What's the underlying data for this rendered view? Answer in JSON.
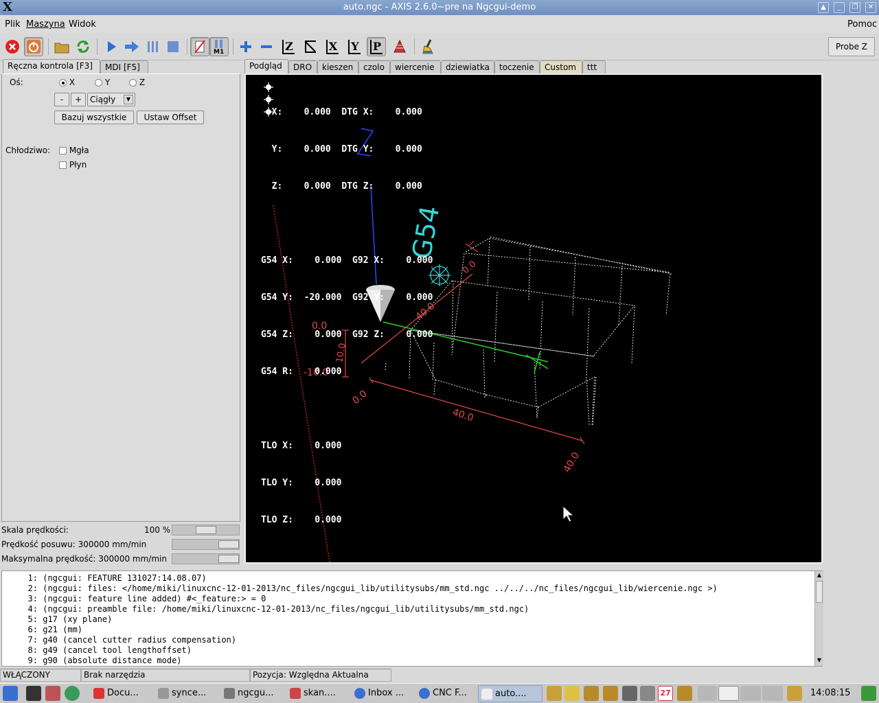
{
  "window": {
    "title": "auto.ngc - AXIS 2.6.0~pre na Ngcgui-demo"
  },
  "menu": [
    "Plik",
    "Maszyna",
    "Widok"
  ],
  "menu_help": "Pomoc",
  "toolbar": {
    "probe_label": "Probe Z",
    "z_label": "Z",
    "y_label": "Y",
    "x_label": "X",
    "p_label": "P"
  },
  "left_tabs": [
    "Ręczna kontrola [F3]",
    "MDI [F5]"
  ],
  "manual": {
    "axis_label": "Oś:",
    "axes": [
      "X",
      "Y",
      "Z"
    ],
    "minus": "-",
    "plus": "+",
    "jog_mode": "Ciągły",
    "home_all": "Bazuj wszystkie",
    "set_offset": "Ustaw Offset",
    "coolant_label": "Chłodziwo:",
    "mist": "Mgła",
    "flood": "Płyn"
  },
  "overrides": {
    "speed_scale_label": "Skala prędkości:",
    "speed_scale_value": "100 %",
    "feed_label": "Prędkość posuwu: 300000 mm/min",
    "max_vel_label": "Maksymalna prędkość: 300000 mm/min"
  },
  "preview_tabs": [
    "Podgląd",
    "DRO",
    "kieszen",
    "czolo",
    "wiercenie",
    "dziewiatka",
    "toczenie",
    "Custom",
    "ttt"
  ],
  "dro": [
    "  X:    0.000  DTG X:    0.000",
    "  Y:    0.000  DTG Y:    0.000",
    "  Z:    0.000  DTG Z:    0.000",
    "",
    "G54 X:    0.000  G92 X:    0.000",
    "G54 Y:  -20.000  G92 Y:    0.000",
    "G54 Z:    0.000  G92 Z:    0.000",
    "G54 R:    0.000",
    "",
    "TLO X:    0.000",
    "TLO Y:    0.000",
    "TLO Z:    0.000"
  ],
  "plot_labels": {
    "g54": "G54",
    "x_top": "40.0",
    "x_bottom": "40.0",
    "x_zero": "0.0",
    "y_end": "40.0",
    "z_zero": "0.0",
    "z_ten": "10.0",
    "z_neg": "-10.0",
    "y_zero": "0.0"
  },
  "code_lines": [
    {
      "n": "1:",
      "t": "(ngcgui: FEATURE 131027:14.08.07)"
    },
    {
      "n": "2:",
      "t": "(ngcgui: files: </home/miki/linuxcnc-12-01-2013/nc_files/ngcgui_lib/utilitysubs/mm_std.ngc ../../../nc_files/ngcgui_lib/wiercenie.ngc >)"
    },
    {
      "n": "3:",
      "t": "(ngcgui: feature line added) #<_feature:> = 0"
    },
    {
      "n": "4:",
      "t": "(ngcgui: preamble file: /home/miki/linuxcnc-12-01-2013/nc_files/ngcgui_lib/utilitysubs/mm_std.ngc)"
    },
    {
      "n": "5:",
      "t": "g17 (xy plane)"
    },
    {
      "n": "6:",
      "t": "g21 (mm)"
    },
    {
      "n": "7:",
      "t": "g40 (cancel cutter radius compensation)"
    },
    {
      "n": "8:",
      "t": "g49 (cancel tool lengthoffset)"
    },
    {
      "n": "9:",
      "t": "g90 (absolute distance mode)"
    }
  ],
  "status": {
    "machine": "WŁĄCZONY",
    "tool": "Brak narzędzia",
    "position": "Pozycja: Względna Aktualna"
  },
  "taskbar": {
    "items": [
      "Docu...",
      "synce...",
      "ngcgu...",
      "skan....",
      "Inbox ...",
      "CNC F...",
      "auto...."
    ],
    "clock": "14:08:15",
    "calendar_day": "27"
  }
}
